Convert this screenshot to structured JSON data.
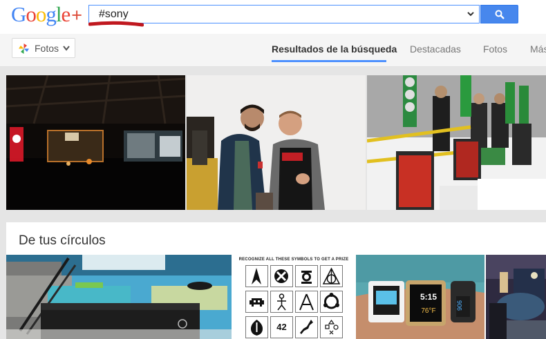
{
  "logo": {
    "text": "Google",
    "plus": "+"
  },
  "search": {
    "value": "#sony"
  },
  "subnav": {
    "fotos_label": "Fotos",
    "tabs": [
      {
        "label": "Resultados de la búsqueda",
        "active": true
      },
      {
        "label": "Destacadas",
        "active": false
      },
      {
        "label": "Fotos",
        "active": false
      },
      {
        "label": "Más",
        "active": false
      }
    ]
  },
  "photos": [
    {
      "subject": "dark event hall with stage lights"
    },
    {
      "subject": "two men posing for photo"
    },
    {
      "subject": "exhibition display with green pillars"
    }
  ],
  "circles": {
    "title": "De tus círculos",
    "thumbs": [
      {
        "subject": "game console in living room"
      },
      {
        "subject": "symbols puzzle poster",
        "heading": "RECOGNIZE ALL THESE SYMBOLS TO GET A PRIZE",
        "number": "42"
      },
      {
        "subject": "smartwatches on wrist",
        "watch_time": "5:15",
        "watch_temp": "76°F",
        "band_text": "906"
      },
      {
        "subject": "exhibition interior"
      }
    ]
  },
  "colors": {
    "accent": "#4d90fe",
    "search_button": "#4787ed",
    "google_red": "#dd4b39"
  }
}
